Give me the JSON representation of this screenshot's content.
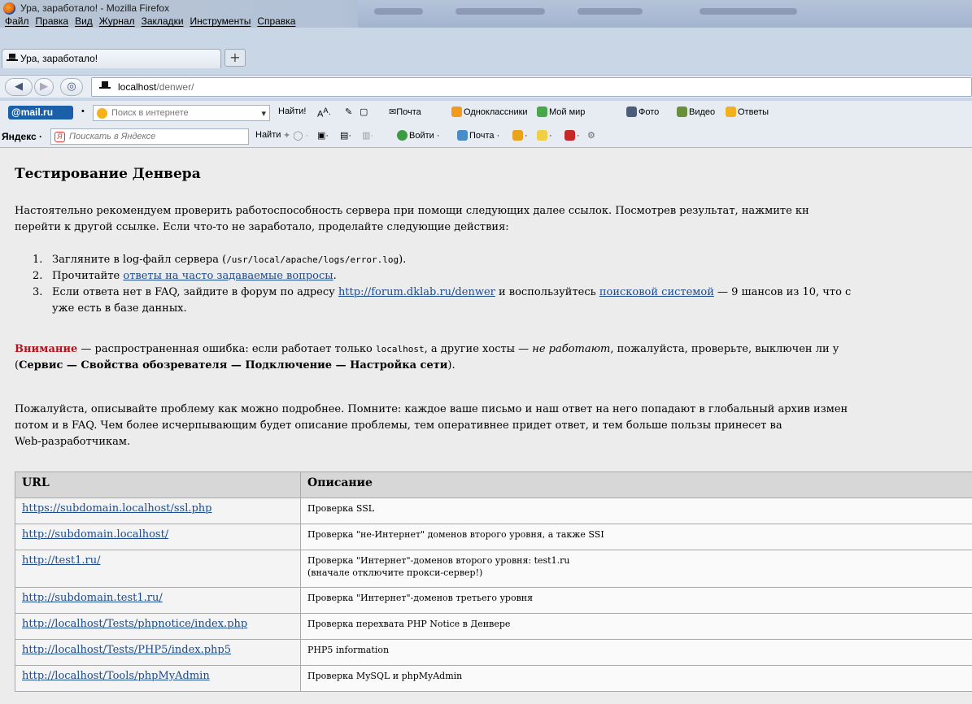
{
  "window": {
    "title": "Ура, заработало! - Mozilla Firefox"
  },
  "menu": [
    "Файл",
    "Правка",
    "Вид",
    "Журнал",
    "Закладки",
    "Инструменты",
    "Справка"
  ],
  "tab": {
    "label": "Ура, заработало!",
    "new_tab": "+"
  },
  "nav": {
    "url_host": "localhost",
    "url_path": "/denwer/"
  },
  "toolbar1": {
    "brand": "@mail.ru",
    "search_placeholder": "Поиск в интернете",
    "find": "Найти!",
    "links": [
      "Почта",
      "Одноклассники",
      "Мой мир",
      "Фото",
      "Видео",
      "Ответы"
    ]
  },
  "toolbar2": {
    "brand": "Яндекс",
    "search_placeholder": "Поискать в Яндексе",
    "find": "Найти",
    "login": "Войти",
    "mail": "Почта"
  },
  "page": {
    "heading": "Тестирование Денвера",
    "intro_line1": "Настоятельно рекомендуем проверить работоспособность сервера при помощи следующих далее ссылок. Посмотрев результат, нажмите кн",
    "intro_line2": "перейти к другой ссылке. Если что-то не заработало, проделайте следующие действия:",
    "steps": {
      "s1_num": "1.",
      "s1_a": "Загляните в log-файл сервера (",
      "s1_code": "/usr/local/apache/logs/error.log",
      "s1_b": ").",
      "s2_num": "2.",
      "s2_a": "Прочитайте ",
      "s2_link": "ответы на часто задаваемые вопросы",
      "s2_b": ".",
      "s3_num": "3.",
      "s3_a": "Если ответа нет в FAQ, зайдите в форум по адресу ",
      "s3_link1": "http://forum.dklab.ru/denwer",
      "s3_b": " и воспользуйтесь ",
      "s3_link2": "поисковой системой",
      "s3_c": " — 9 шансов из 10, что с",
      "s3_line2": "уже есть в базе данных."
    },
    "warning": {
      "label": "Внимание",
      "a": " — распространенная ошибка: если работает только ",
      "code": "localhost",
      "b": ", а другие хосты — ",
      "em": "не работают",
      "c": ", пожалуйста, проверьте, выключен ли у",
      "line2_open": "(",
      "line2_bold": "Сервис — Свойства обозревателя — Подключение — Настройка сети",
      "line2_close": ")."
    },
    "please_line1": "Пожалуйста, описывайте проблему как можно подробнее. Помните: каждое ваше письмо и наш ответ на него попадают в глобальный архив измен",
    "please_line2": "потом и в FAQ. Чем более исчерпывающим будет описание проблемы, тем оперативнее придет ответ, и тем больше пользы принесет ва",
    "please_line3": "Web-разработчикам."
  },
  "table": {
    "headers": [
      "URL",
      "Описание"
    ],
    "rows": [
      {
        "url": "https://subdomain.localhost/ssl.php",
        "desc": "Проверка SSL",
        "desc2": ""
      },
      {
        "url": "http://subdomain.localhost/",
        "desc": "Проверка \"не-Интернет\" доменов второго уровня, а также SSI",
        "desc2": ""
      },
      {
        "url": "http://test1.ru/",
        "desc": "Проверка \"Интернет\"-доменов второго уровня: test1.ru",
        "desc2": "(вначале отключите прокси-сервер!)"
      },
      {
        "url": "http://subdomain.test1.ru/",
        "desc": "Проверка \"Интернет\"-доменов третьего уровня",
        "desc2": ""
      },
      {
        "url": "http://localhost/Tests/phpnotice/index.php",
        "desc": "Проверка перехвата PHP Notice в Денвере",
        "desc2": ""
      },
      {
        "url": "http://localhost/Tests/PHP5/index.php5",
        "desc": "PHP5 information",
        "desc2": ""
      },
      {
        "url": "http://localhost/Tools/phpMyAdmin",
        "desc": "Проверка MySQL и phpMyAdmin",
        "desc2": ""
      }
    ]
  }
}
